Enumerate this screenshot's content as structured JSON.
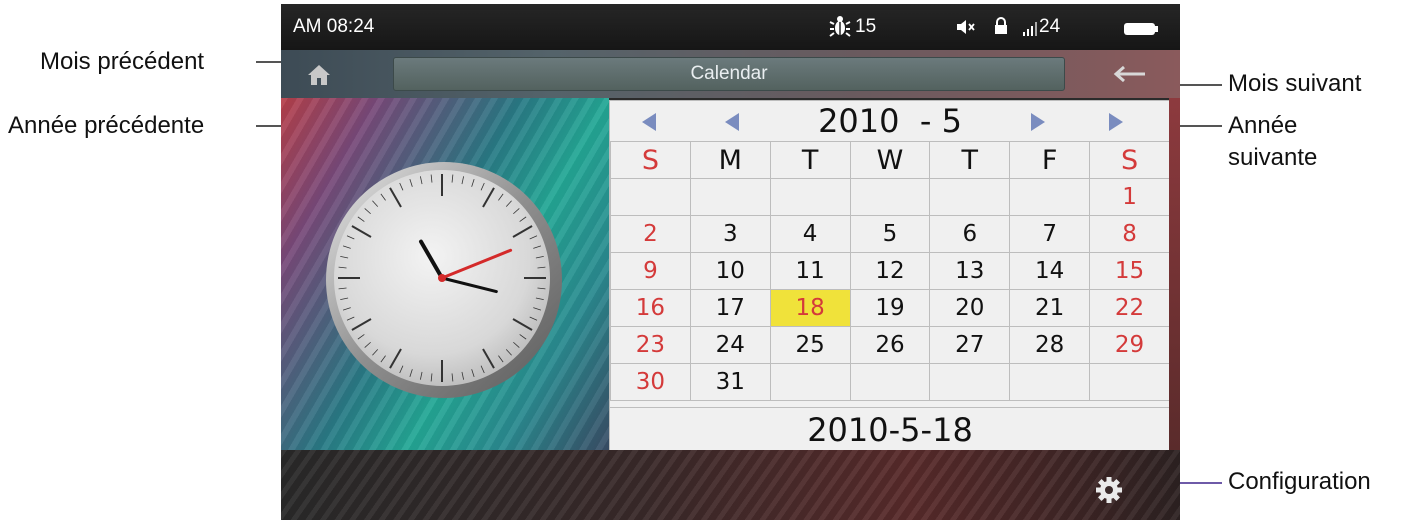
{
  "status_bar": {
    "time": "AM 08:24",
    "bug_count": "15",
    "signal": "24"
  },
  "title_bar": {
    "title": "Calendar",
    "home_icon": "home-icon",
    "back_icon": "back-arrow-icon"
  },
  "calendar": {
    "header": "2010  - 5",
    "weekdays": [
      "S",
      "M",
      "T",
      "W",
      "T",
      "F",
      "S"
    ],
    "weeks": [
      [
        "",
        "",
        "",
        "",
        "",
        "",
        "1"
      ],
      [
        "2",
        "3",
        "4",
        "5",
        "6",
        "7",
        "8"
      ],
      [
        "9",
        "10",
        "11",
        "12",
        "13",
        "14",
        "15"
      ],
      [
        "16",
        "17",
        "18",
        "19",
        "20",
        "21",
        "22"
      ],
      [
        "23",
        "24",
        "25",
        "26",
        "27",
        "28",
        "29"
      ],
      [
        "30",
        "31",
        "",
        "",
        "",
        "",
        ""
      ]
    ],
    "selected_date": "2010-5-18",
    "today": "18"
  },
  "annotations": {
    "prev_month": "Mois précédent",
    "prev_year": "Année précédente",
    "next_month": "Mois suivant",
    "next_year_line1": "Année",
    "next_year_line2": "suivante",
    "settings": "Configuration"
  },
  "colors": {
    "weekend": "#d43a3a",
    "today_highlight": "#f0e23a",
    "nav_arrow": "#7a8cbf",
    "annotation_line": "#6e5aa8"
  },
  "clock": {
    "hour_hand_deg": -30,
    "minute_hand_deg": 104,
    "second_hand_deg": 68
  }
}
